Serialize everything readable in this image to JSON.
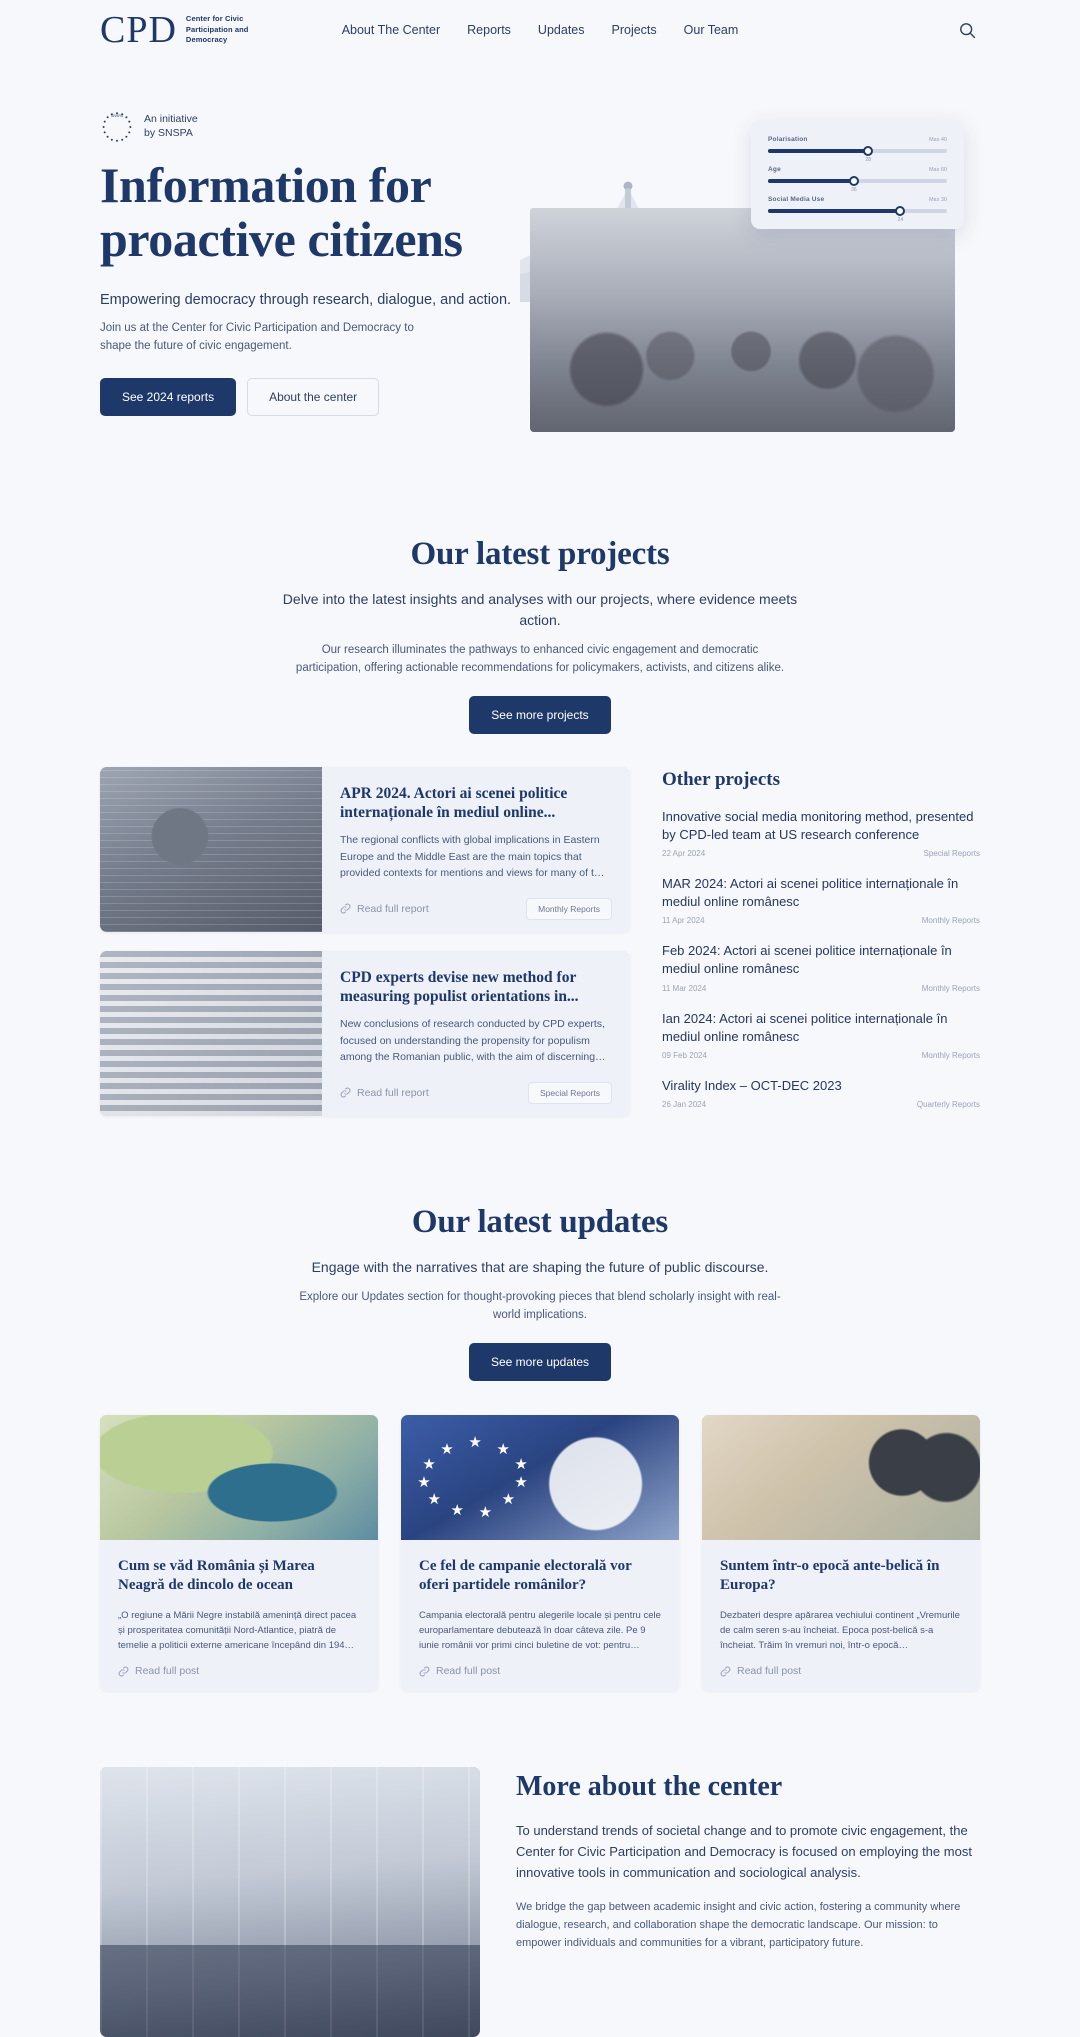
{
  "header": {
    "logo_mark": "CPD",
    "logo_sub": "Center for Civic Participation and Democracy",
    "nav": [
      {
        "label": "About The Center"
      },
      {
        "label": "Reports"
      },
      {
        "label": "Updates"
      },
      {
        "label": "Projects"
      },
      {
        "label": "Our Team"
      }
    ],
    "search_icon": "search-icon"
  },
  "hero": {
    "badge_line1": "An initiative",
    "badge_line2": "by SNSPA",
    "badge_ring_label": "SNSPA",
    "title": "Information for proactive citizens",
    "lead": "Empowering democracy through research, dialogue, and action.",
    "sub": "Join us at the Center for Civic Participation and Democracy to shape the future of civic engagement.",
    "primary_btn": "See 2024 reports",
    "secondary_btn": "About the center",
    "sliders": [
      {
        "label": "Polarisation",
        "max_label": "Max 40",
        "value": "28",
        "percent": 56
      },
      {
        "label": "Age",
        "max_label": "Max 60",
        "value": "36",
        "percent": 48
      },
      {
        "label": "Social Media Use",
        "max_label": "Max 30",
        "value": "24",
        "percent": 74
      }
    ]
  },
  "projects": {
    "title": "Our latest projects",
    "lead": "Delve into the latest insights and analyses with our projects, where evidence meets action.",
    "desc": "Our research illuminates the pathways to enhanced civic engagement and democratic participation, offering actionable recommendations for policymakers, activists, and citizens alike.",
    "cta": "See more projects",
    "cards": [
      {
        "title": "APR 2024. Actori ai scenei politice internaționale în mediul online...",
        "desc": "The regional conflicts with global implications in Eastern Europe and the Middle East are the main topics that provided contexts for mentions and views for many of t…",
        "read": "Read full report",
        "badge": "Monthly Reports"
      },
      {
        "title": "CPD experts devise new method for measuring populist orientations in...",
        "desc": "New conclusions of research conducted by CPD experts, focused on understanding the propensity for populism among the Romanian public, with the aim of discerning…",
        "read": "Read full report",
        "badge": "Special Reports"
      }
    ],
    "other_title": "Other projects",
    "other_items": [
      {
        "title": "Innovative social media monitoring method, presented by CPD-led team at US research conference",
        "date": "22 Apr 2024",
        "tag": "Special Reports"
      },
      {
        "title": "MAR 2024: Actori ai scenei politice internaționale în mediul online românesc",
        "date": "11 Apr 2024",
        "tag": "Monthly Reports"
      },
      {
        "title": "Feb 2024: Actori ai scenei politice internaționale în mediul online românesc",
        "date": "11 Mar 2024",
        "tag": "Monthly Reports"
      },
      {
        "title": "Ian 2024: Actori ai scenei politice internaționale în mediul online românesc",
        "date": "09 Feb 2024",
        "tag": "Monthly Reports"
      },
      {
        "title": "Virality Index – OCT-DEC 2023",
        "date": "26 Jan 2024",
        "tag": "Quarterly Reports"
      }
    ]
  },
  "updates": {
    "title": "Our latest updates",
    "lead": "Engage with the narratives that are shaping the future of public discourse.",
    "desc": "Explore our Updates section for thought-provoking pieces that blend scholarly insight with real-world implications.",
    "cta": "See more updates",
    "cards": [
      {
        "title": "Cum se văd România și Marea Neagră de dincolo de ocean",
        "desc": "„O regiune a Mării Negre instabilă amenință direct pacea și prosperitatea comunității Nord-Atlantice, piatră de temelie a politicii externe americane începând din 194…",
        "read": "Read full post"
      },
      {
        "title": "Ce fel de campanie electorală vor oferi partidele românilor?",
        "desc": "Campania electorală pentru alegerile locale și pentru cele europarlamentare debutează în doar câteva zile. Pe 9 iunie românii vor primi cinci buletine de vot: pentru…",
        "read": "Read full post"
      },
      {
        "title": "Suntem într-o epocă ante-belică în Europa?",
        "desc": "Dezbateri despre apărarea vechiului continent „Vremurile de calm seren s-au încheiat. Epoca post-belică s-a încheiat. Trăim în vremuri noi, într-o epocă…",
        "read": "Read full post"
      }
    ]
  },
  "about": {
    "title": "More about the center",
    "p1": "To understand trends of societal change and to promote civic engagement, the Center for Civic Participation and Democracy is focused on employing the most innovative tools in communication and sociological analysis.",
    "p2": "We bridge the gap between academic insight and civic action, fostering a community where dialogue, research, and collaboration shape the democratic landscape. Our mission: to empower individuals and communities for a vibrant, participatory future."
  },
  "colors": {
    "brand": "#1e3869",
    "page_bg": "#f7f8fb",
    "card_bg": "#eef1f8",
    "muted": "#8b94a8"
  }
}
